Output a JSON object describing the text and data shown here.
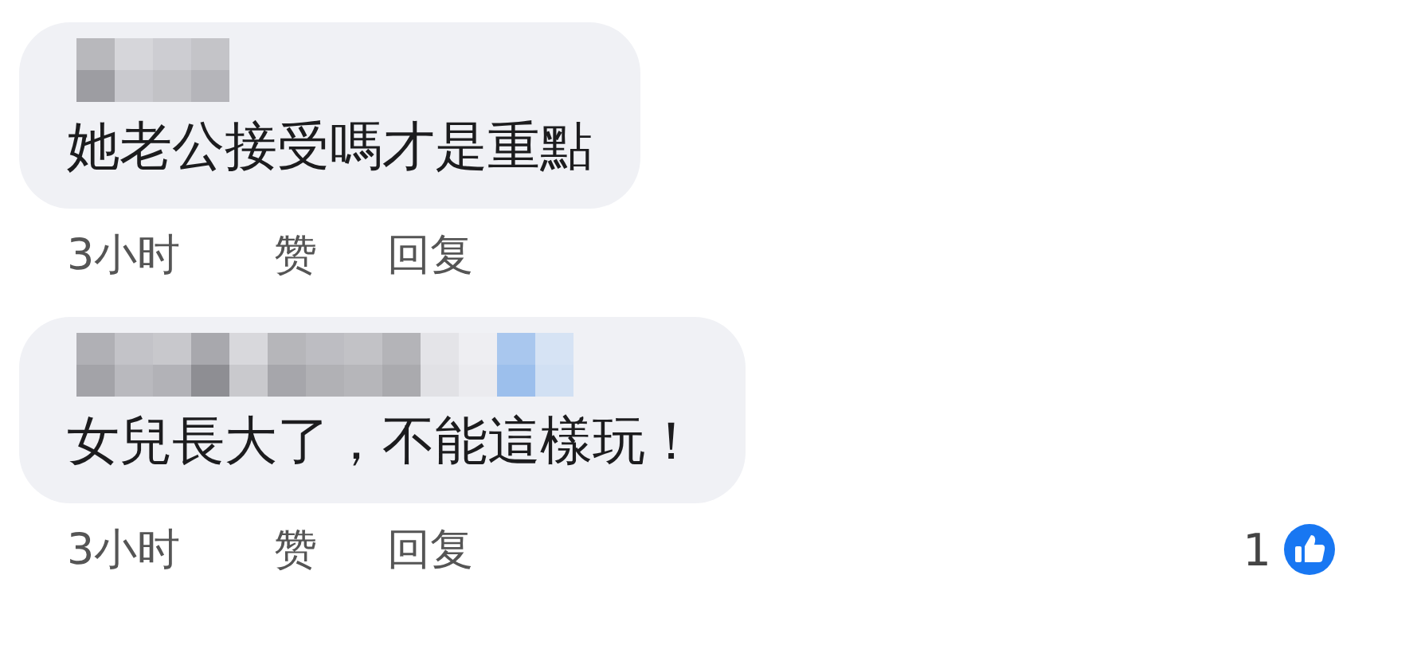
{
  "comments": [
    {
      "text": "她老公接受嗎才是重點",
      "time": "3小时",
      "like": "赞",
      "reply": "回复"
    },
    {
      "text": "女兒長大了，不能這樣玩！",
      "time": "3小时",
      "like": "赞",
      "reply": "回复",
      "reactions": {
        "count": "1"
      }
    }
  ]
}
